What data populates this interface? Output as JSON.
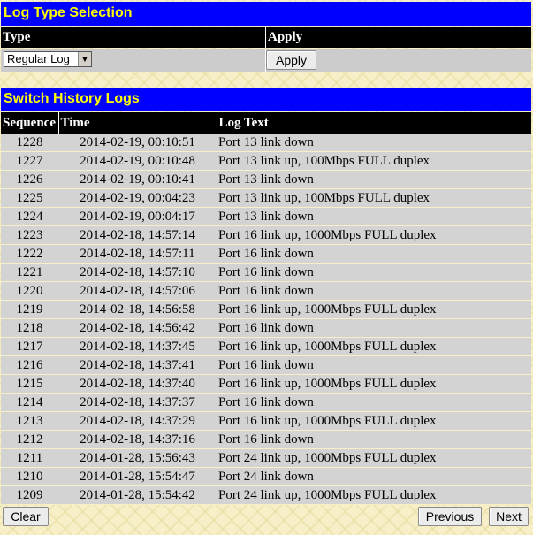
{
  "log_type_section": {
    "title": "Log Type Selection",
    "type_header": "Type",
    "apply_header": "Apply",
    "type_selected": "Regular Log",
    "apply_button": "Apply"
  },
  "history_section": {
    "title": "Switch History Logs",
    "columns": [
      "Sequence",
      "Time",
      "Log Text"
    ],
    "rows": [
      {
        "seq": "1228",
        "time": "2014-02-19, 00:10:51",
        "text": "Port 13 link down"
      },
      {
        "seq": "1227",
        "time": "2014-02-19, 00:10:48",
        "text": "Port 13 link up, 100Mbps FULL duplex"
      },
      {
        "seq": "1226",
        "time": "2014-02-19, 00:10:41",
        "text": "Port 13 link down"
      },
      {
        "seq": "1225",
        "time": "2014-02-19, 00:04:23",
        "text": "Port 13 link up, 100Mbps FULL duplex"
      },
      {
        "seq": "1224",
        "time": "2014-02-19, 00:04:17",
        "text": "Port 13 link down"
      },
      {
        "seq": "1223",
        "time": "2014-02-18, 14:57:14",
        "text": "Port 16 link up, 1000Mbps FULL duplex"
      },
      {
        "seq": "1222",
        "time": "2014-02-18, 14:57:11",
        "text": "Port 16 link down"
      },
      {
        "seq": "1221",
        "time": "2014-02-18, 14:57:10",
        "text": "Port 16 link down"
      },
      {
        "seq": "1220",
        "time": "2014-02-18, 14:57:06",
        "text": "Port 16 link down"
      },
      {
        "seq": "1219",
        "time": "2014-02-18, 14:56:58",
        "text": "Port 16 link up, 1000Mbps FULL duplex"
      },
      {
        "seq": "1218",
        "time": "2014-02-18, 14:56:42",
        "text": "Port 16 link down"
      },
      {
        "seq": "1217",
        "time": "2014-02-18, 14:37:45",
        "text": "Port 16 link up, 1000Mbps FULL duplex"
      },
      {
        "seq": "1216",
        "time": "2014-02-18, 14:37:41",
        "text": "Port 16 link down"
      },
      {
        "seq": "1215",
        "time": "2014-02-18, 14:37:40",
        "text": "Port 16 link up, 1000Mbps FULL duplex"
      },
      {
        "seq": "1214",
        "time": "2014-02-18, 14:37:37",
        "text": "Port 16 link down"
      },
      {
        "seq": "1213",
        "time": "2014-02-18, 14:37:29",
        "text": "Port 16 link up, 1000Mbps FULL duplex"
      },
      {
        "seq": "1212",
        "time": "2014-02-18, 14:37:16",
        "text": "Port 16 link down"
      },
      {
        "seq": "1211",
        "time": "2014-01-28, 15:56:43",
        "text": "Port 24 link up, 1000Mbps FULL duplex"
      },
      {
        "seq": "1210",
        "time": "2014-01-28, 15:54:47",
        "text": "Port 24 link down"
      },
      {
        "seq": "1209",
        "time": "2014-01-28, 15:54:42",
        "text": "Port 24 link up, 1000Mbps FULL duplex"
      }
    ]
  },
  "footer": {
    "clear_button": "Clear",
    "previous_button": "Previous",
    "next_button": "Next"
  }
}
